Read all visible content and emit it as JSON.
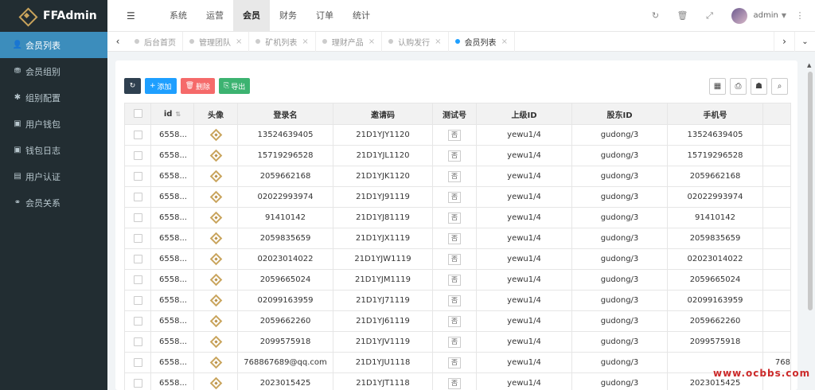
{
  "app": {
    "title": "FFAdmin"
  },
  "sidebar": {
    "items": [
      {
        "label": "会员列表",
        "icon": "user-icon",
        "glyph": "👤",
        "active": true
      },
      {
        "label": "会员组别",
        "icon": "group-icon",
        "glyph": "⛃",
        "active": false
      },
      {
        "label": "组别配置",
        "icon": "gear-icon",
        "glyph": "✱",
        "active": false
      },
      {
        "label": "用户钱包",
        "icon": "wallet-icon",
        "glyph": "▣",
        "active": false
      },
      {
        "label": "钱包日志",
        "icon": "log-icon",
        "glyph": "▣",
        "active": false
      },
      {
        "label": "用户认证",
        "icon": "id-card-icon",
        "glyph": "▤",
        "active": false
      },
      {
        "label": "会员关系",
        "icon": "relation-icon",
        "glyph": "⚭",
        "active": false
      }
    ]
  },
  "topnav": {
    "items": [
      {
        "label": "系统",
        "active": false
      },
      {
        "label": "运营",
        "active": false
      },
      {
        "label": "会员",
        "active": true
      },
      {
        "label": "财务",
        "active": false
      },
      {
        "label": "订单",
        "active": false
      },
      {
        "label": "统计",
        "active": false
      }
    ],
    "user": "admin"
  },
  "tabs": [
    {
      "label": "后台首页",
      "active": false,
      "closable": false
    },
    {
      "label": "管理团队",
      "active": false,
      "closable": true
    },
    {
      "label": "矿机列表",
      "active": false,
      "closable": true
    },
    {
      "label": "理财产品",
      "active": false,
      "closable": true
    },
    {
      "label": "认购发行",
      "active": false,
      "closable": true
    },
    {
      "label": "会员列表",
      "active": true,
      "closable": true
    }
  ],
  "toolbar": {
    "add_label": "添加",
    "delete_label": "删除",
    "export_label": "导出"
  },
  "table": {
    "columns": [
      "id",
      "头像",
      "登录名",
      "邀请码",
      "测试号",
      "上级ID",
      "股东ID",
      "手机号"
    ],
    "rows": [
      {
        "id": "6558...",
        "login": "13524639405",
        "invite": "21D1YJY1120",
        "test": "否",
        "parent": "yewu1/4",
        "shareholder": "gudong/3",
        "phone": "13524639405",
        "extra": ""
      },
      {
        "id": "6558...",
        "login": "15719296528",
        "invite": "21D1YJL1120",
        "test": "否",
        "parent": "yewu1/4",
        "shareholder": "gudong/3",
        "phone": "15719296528",
        "extra": ""
      },
      {
        "id": "6558...",
        "login": "2059662168",
        "invite": "21D1YJK1120",
        "test": "否",
        "parent": "yewu1/4",
        "shareholder": "gudong/3",
        "phone": "2059662168",
        "extra": ""
      },
      {
        "id": "6558...",
        "login": "02022993974",
        "invite": "21D1YJ91119",
        "test": "否",
        "parent": "yewu1/4",
        "shareholder": "gudong/3",
        "phone": "02022993974",
        "extra": ""
      },
      {
        "id": "6558...",
        "login": "91410142",
        "invite": "21D1YJ81119",
        "test": "否",
        "parent": "yewu1/4",
        "shareholder": "gudong/3",
        "phone": "91410142",
        "extra": ""
      },
      {
        "id": "6558...",
        "login": "2059835659",
        "invite": "21D1YJX1119",
        "test": "否",
        "parent": "yewu1/4",
        "shareholder": "gudong/3",
        "phone": "2059835659",
        "extra": ""
      },
      {
        "id": "6558...",
        "login": "02023014022",
        "invite": "21D1YJW1119",
        "test": "否",
        "parent": "yewu1/4",
        "shareholder": "gudong/3",
        "phone": "02023014022",
        "extra": ""
      },
      {
        "id": "6558...",
        "login": "2059665024",
        "invite": "21D1YJM1119",
        "test": "否",
        "parent": "yewu1/4",
        "shareholder": "gudong/3",
        "phone": "2059665024",
        "extra": ""
      },
      {
        "id": "6558...",
        "login": "02099163959",
        "invite": "21D1YJ71119",
        "test": "否",
        "parent": "yewu1/4",
        "shareholder": "gudong/3",
        "phone": "02099163959",
        "extra": ""
      },
      {
        "id": "6558...",
        "login": "2059662260",
        "invite": "21D1YJ61119",
        "test": "否",
        "parent": "yewu1/4",
        "shareholder": "gudong/3",
        "phone": "2059662260",
        "extra": ""
      },
      {
        "id": "6558...",
        "login": "2099575918",
        "invite": "21D1YJV1119",
        "test": "否",
        "parent": "yewu1/4",
        "shareholder": "gudong/3",
        "phone": "2099575918",
        "extra": ""
      },
      {
        "id": "6558...",
        "login": "768867689@qq.com",
        "invite": "21D1YJU1118",
        "test": "否",
        "parent": "yewu1/4",
        "shareholder": "gudong/3",
        "phone": "",
        "extra": "768"
      },
      {
        "id": "6558...",
        "login": "2023015425",
        "invite": "21D1YJT1118",
        "test": "否",
        "parent": "yewu1/4",
        "shareholder": "gudong/3",
        "phone": "2023015425",
        "extra": ""
      }
    ]
  },
  "watermark": "www.ocbbs.com",
  "colors": {
    "sidebar_bg": "#222d32",
    "sidebar_active": "#3c8dbc",
    "add": "#1e9fff",
    "delete": "#f56a6a",
    "export": "#3cb371",
    "gold": "#c9a45c"
  }
}
